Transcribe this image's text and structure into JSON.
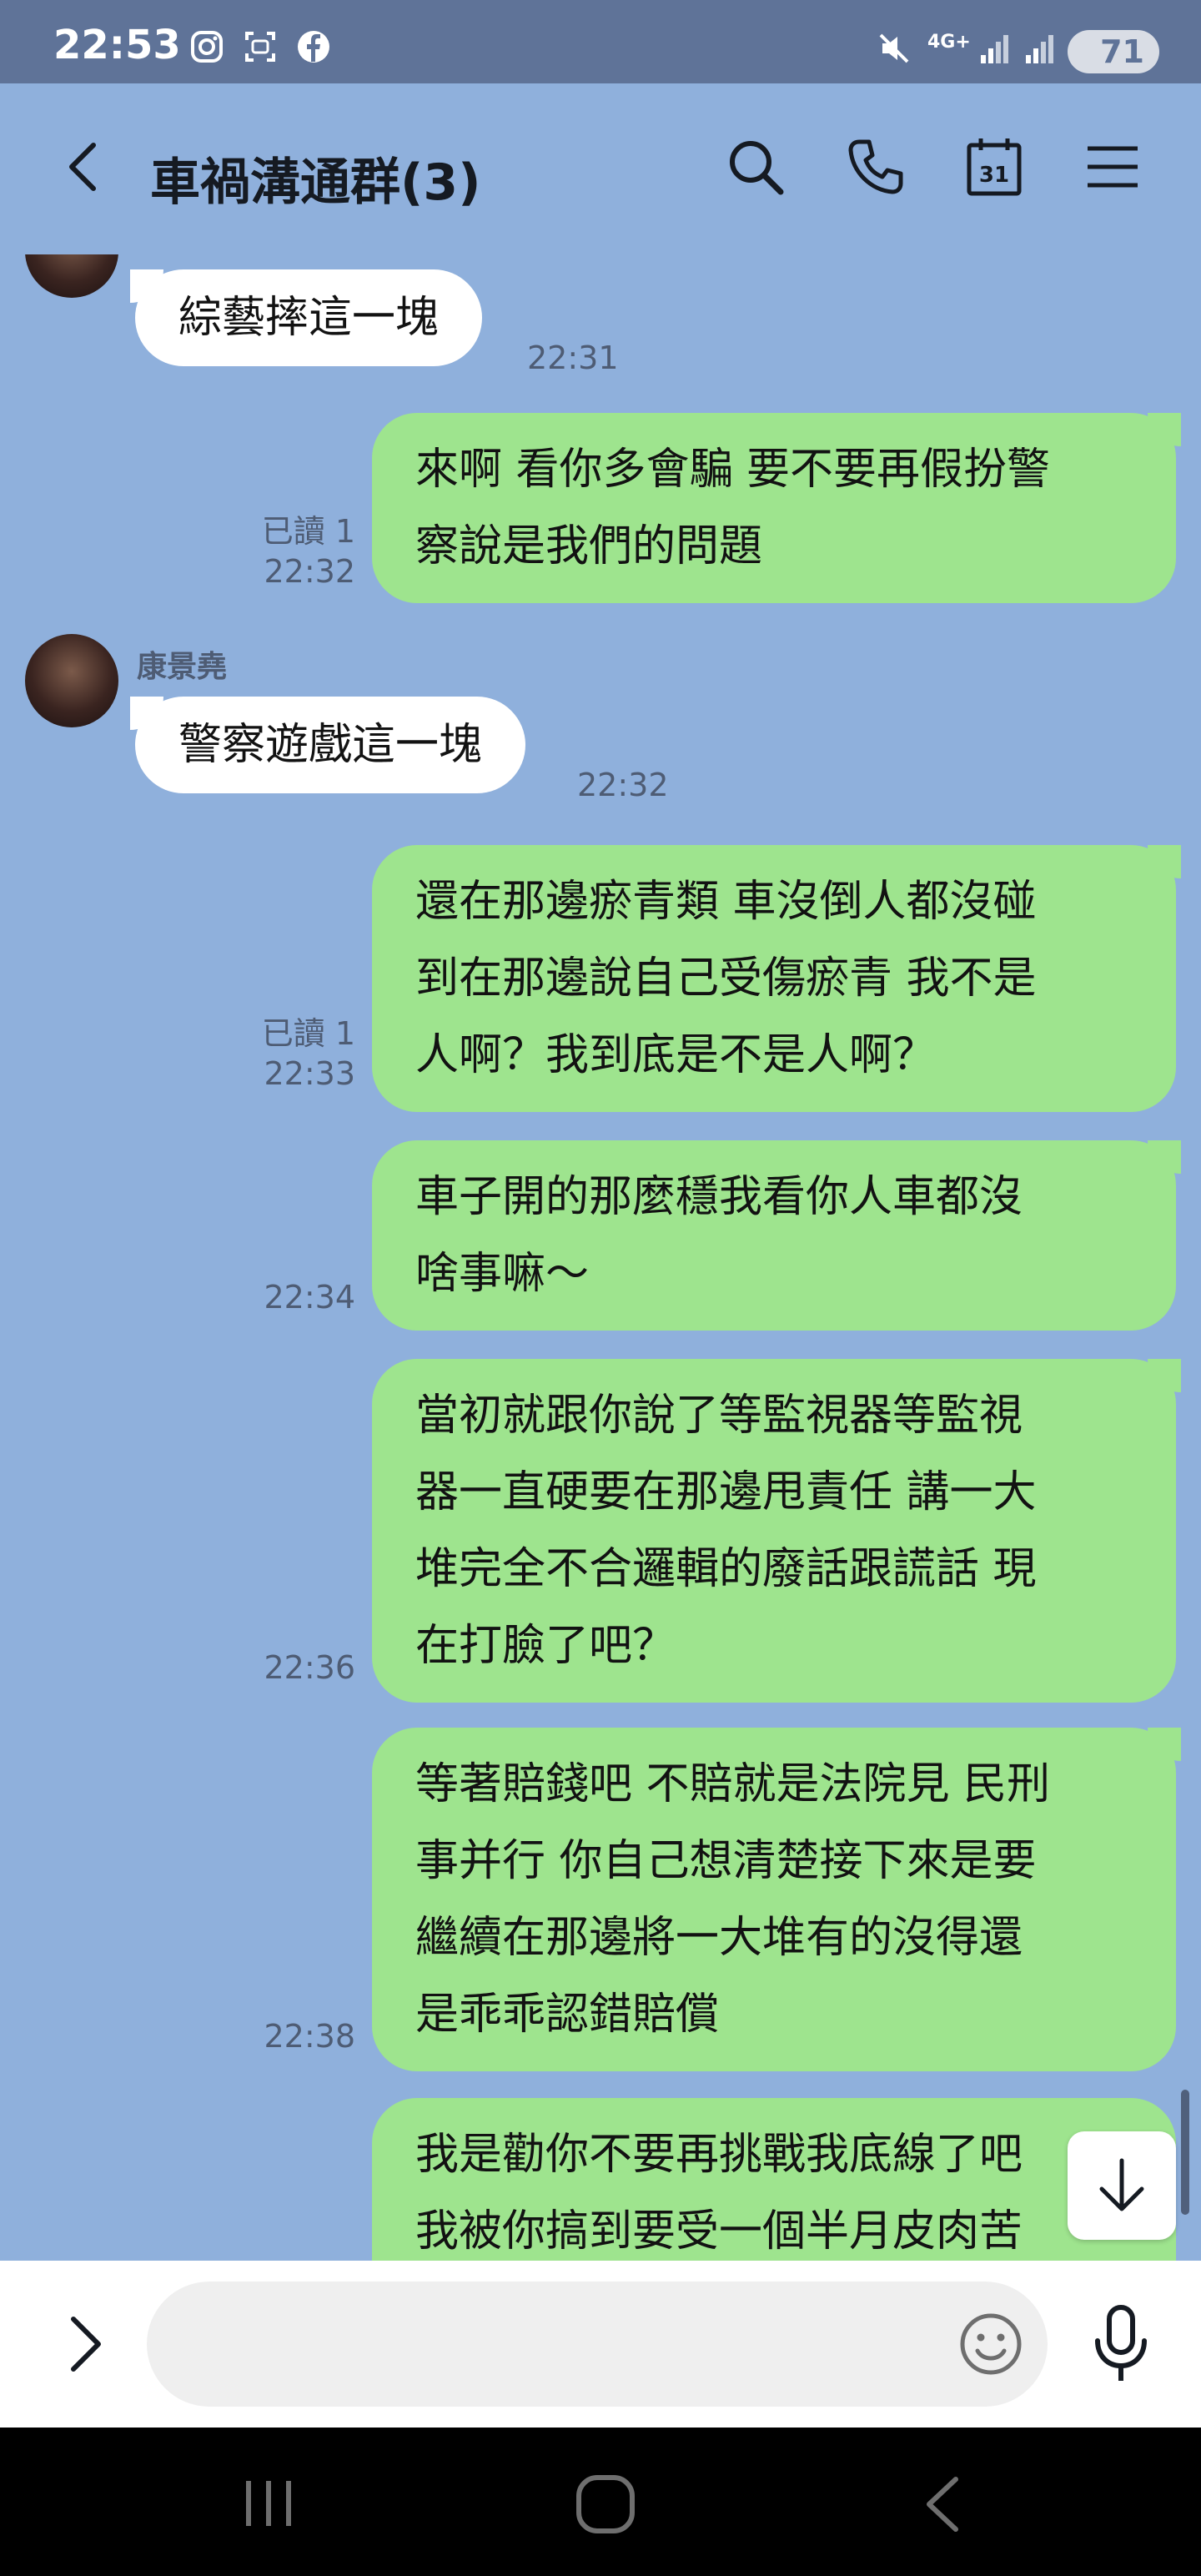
{
  "status_bar": {
    "time": "22:53",
    "network": "4G+",
    "battery": "71"
  },
  "header": {
    "title": "車禍溝通群(3)"
  },
  "messages": [
    {
      "side": "in",
      "sender": "",
      "text": "綜藝摔這一塊",
      "time": "22:31",
      "read": ""
    },
    {
      "side": "out",
      "text_lines": [
        "來啊 看你多會騙 要不要再假扮警",
        "察說是我們的問題"
      ],
      "time": "22:32",
      "read": "已讀 1"
    },
    {
      "side": "in",
      "sender": "康景堯",
      "text": "警察遊戲這一塊",
      "time": "22:32",
      "read": ""
    },
    {
      "side": "out",
      "text_lines": [
        "還在那邊瘀青類 車沒倒人都沒碰",
        "到在那邊說自己受傷瘀青 我不是",
        "人啊？我到底是不是人啊？"
      ],
      "time": "22:33",
      "read": "已讀 1"
    },
    {
      "side": "out",
      "text_lines": [
        "車子開的那麼穩我看你人車都沒",
        "啥事嘛～"
      ],
      "time": "22:34",
      "read": ""
    },
    {
      "side": "out",
      "text_lines": [
        "當初就跟你說了等監視器等監視",
        "器一直硬要在那邊甩責任 講一大",
        "堆完全不合邏輯的廢話跟謊話 現",
        "在打臉了吧？"
      ],
      "time": "22:36",
      "read": ""
    },
    {
      "side": "out",
      "text_lines": [
        "等著賠錢吧 不賠就是法院見 民刑",
        "事并行 你自己想清楚接下來是要",
        "繼續在那邊將一大堆有的沒得還",
        "是乖乖認錯賠償"
      ],
      "time": "22:38",
      "read": ""
    },
    {
      "side": "out",
      "text_lines": [
        "我是勸你不要再挑戰我底線了吧",
        "我被你搞到要受一個半月皮肉苦"
      ],
      "time": "",
      "read": ""
    }
  ],
  "input": {
    "placeholder": "",
    "value": ""
  },
  "colors": {
    "background": "#8fb0dc",
    "status_bar": "#5f7398",
    "bubble_out": "#9ee48e",
    "bubble_in": "#ffffff"
  },
  "icons": [
    "back-icon",
    "search-icon",
    "phone-icon",
    "calendar-icon",
    "menu-icon",
    "expand-icon",
    "emoji-icon",
    "microphone-icon",
    "scroll-down-icon",
    "recent-apps-icon",
    "home-icon",
    "nav-back-icon"
  ],
  "calendar_icon_label": "31"
}
